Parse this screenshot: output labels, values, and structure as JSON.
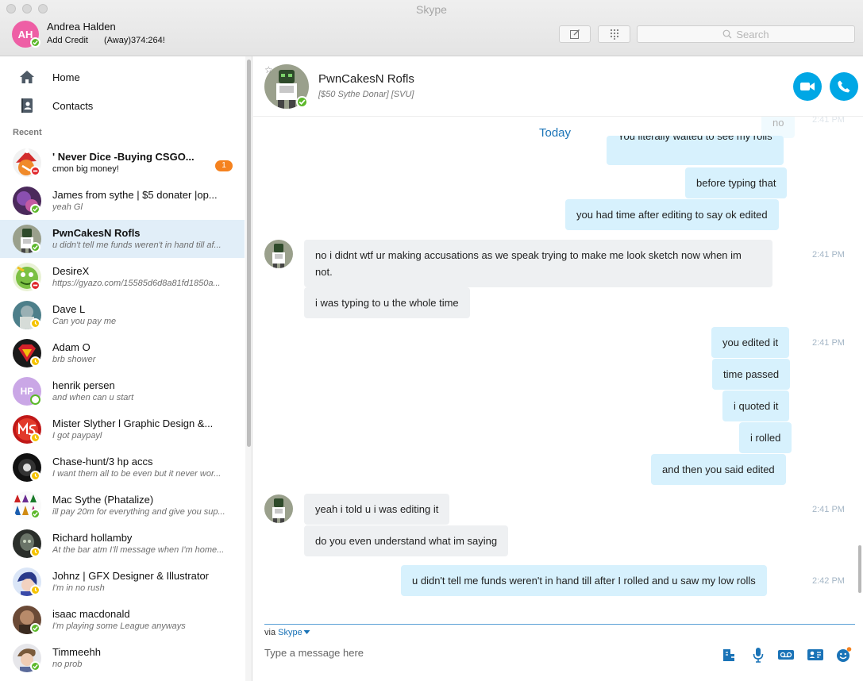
{
  "window": {
    "title": "Skype"
  },
  "me": {
    "initials": "AH",
    "name": "Andrea Halden",
    "credit_label": "Add Credit",
    "mood": "(Away)374:264!",
    "status": "online",
    "avatar_color": "#ee5fa5"
  },
  "toolbar": {
    "search_placeholder": "Search"
  },
  "nav": {
    "home_label": "Home",
    "contacts_label": "Contacts",
    "recent_label": "Recent"
  },
  "contacts": [
    {
      "name": "' Never Dice -Buying CSGO...",
      "message": "cmon big money!",
      "status": "busy",
      "unread": "1",
      "bold": true
    },
    {
      "name": "James from sythe | $5 donater |op...",
      "message": "yeah Gl",
      "status": "online"
    },
    {
      "name": "PwnCakesN Rofls",
      "message": "u didn't tell me funds weren't in hand till af...",
      "status": "online",
      "selected": true
    },
    {
      "name": "DesireX",
      "message": "https://gyazo.com/15585d6d8a81fd1850a...",
      "status": "busy"
    },
    {
      "name": "Dave L",
      "message": "Can you pay me",
      "status": "away"
    },
    {
      "name": "Adam O",
      "message": "brb shower",
      "status": "away"
    },
    {
      "name": "henrik persen",
      "message": "and when can u start",
      "status": "offline",
      "initials": "HP"
    },
    {
      "name": "Mister Slyther l Graphic Design &...",
      "message": "I got paypayl",
      "status": "away"
    },
    {
      "name": "Chase-hunt/3 hp accs",
      "message": "I want them all to be even but it never wor...",
      "status": "away"
    },
    {
      "name": "Mac Sythe (Phatalize)",
      "message": "ill pay 20m for everything and give you sup...",
      "status": "online"
    },
    {
      "name": "Richard hollamby",
      "message": "At the bar atm I'll message when I'm home...",
      "status": "away"
    },
    {
      "name": "Johnz | GFX Designer & Illustrator",
      "message": "I'm in no rush",
      "status": "away"
    },
    {
      "name": "isaac macdonald",
      "message": "I'm playing some League anyways",
      "status": "online"
    },
    {
      "name": "Timmeehh",
      "message": "no prob",
      "status": "online"
    }
  ],
  "conversation": {
    "name": "PwnCakesN Rofls",
    "mood": "[$50 Sythe Donar] [SVU]",
    "status": "online",
    "date_divider": "Today",
    "faded": {
      "text": "no",
      "time": "2:41 PM"
    },
    "partial_top": "You literally waited to see my rolls",
    "messages": [
      {
        "dir": "out",
        "text": "before typing that"
      },
      {
        "dir": "out",
        "text": "you had time after editing to say ok edited"
      },
      {
        "dir": "in",
        "text": "no i didnt wtf ur making accusations as we speak trying to make me look sketch now when im not.",
        "time": "2:41 PM"
      },
      {
        "dir": "in",
        "text": "i was typing to u the whole time"
      },
      {
        "dir": "out",
        "text": "you edited it",
        "time": "2:41 PM"
      },
      {
        "dir": "out",
        "text": "time passed"
      },
      {
        "dir": "out",
        "text": "i quoted it"
      },
      {
        "dir": "out",
        "text": "i rolled"
      },
      {
        "dir": "out",
        "text": "and then you said edited"
      },
      {
        "dir": "in",
        "text": "yeah i told u i was editing it",
        "time": "2:41 PM"
      },
      {
        "dir": "in",
        "text": "do you even understand what im saying"
      },
      {
        "dir": "out",
        "text": "u didn't tell me funds weren't in hand till after I rolled and u saw my low rolls",
        "time": "2:42 PM"
      }
    ]
  },
  "composer": {
    "via_label": "via",
    "via_link": "Skype",
    "placeholder": "Type a message here"
  },
  "colors": {
    "accent": "#00a7e5",
    "link": "#1a73b7",
    "bubble_out": "#d7f1fd",
    "bubble_in": "#eef0f2",
    "selected_row": "#e1eef8",
    "badge": "#f5821f"
  }
}
